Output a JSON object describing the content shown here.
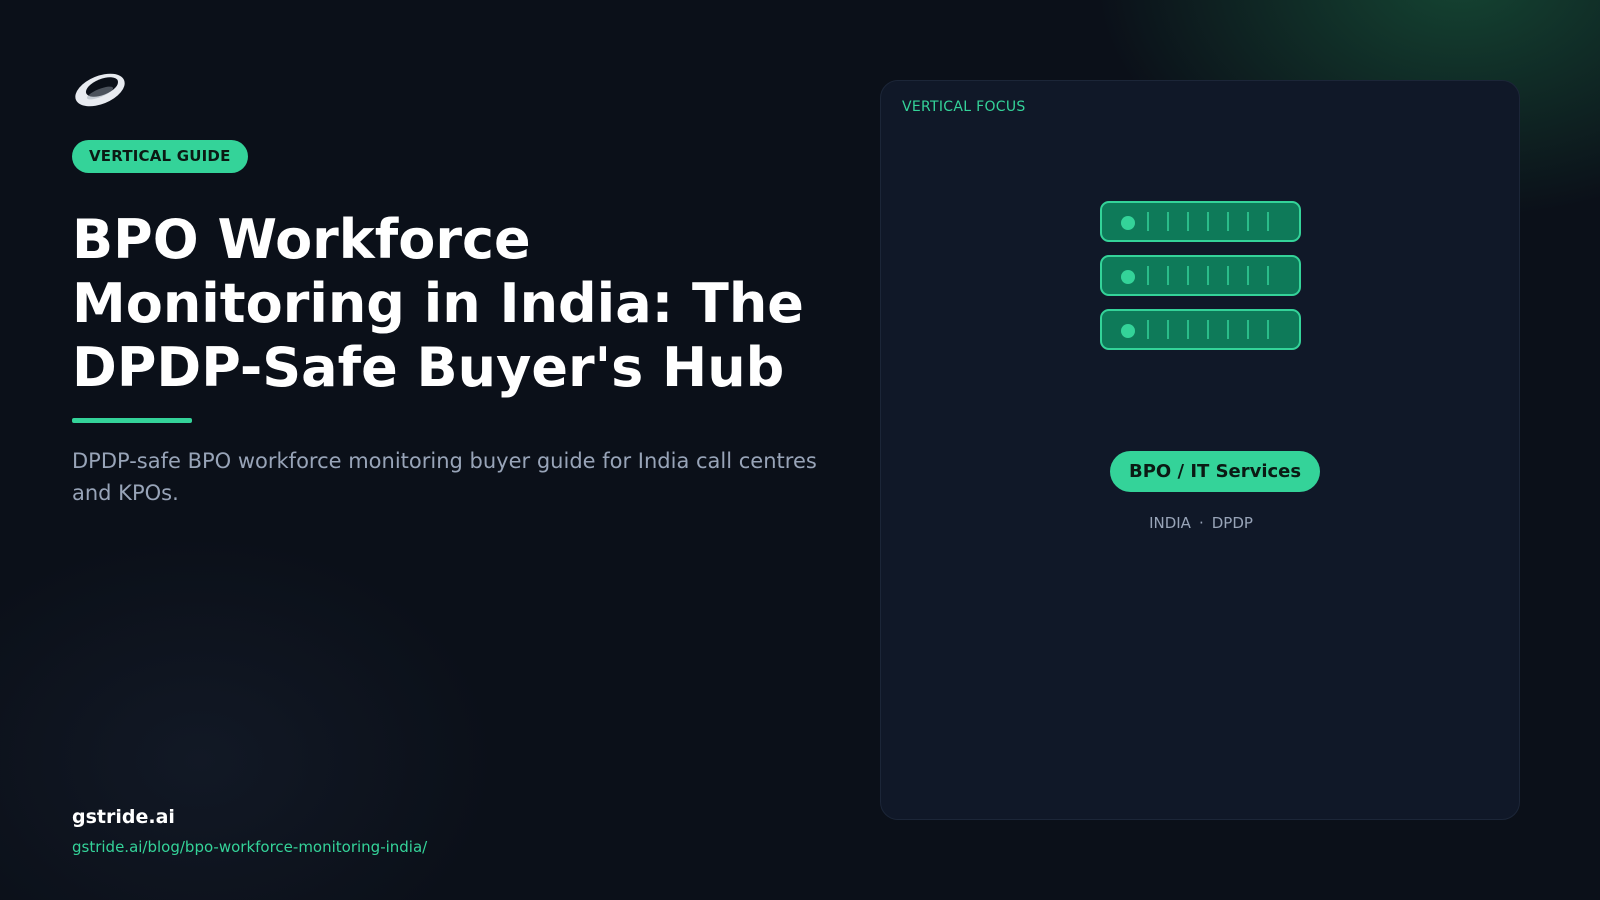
{
  "header": {
    "logo_icon": "ring-logo-icon"
  },
  "hero": {
    "tag": "VERTICAL GUIDE",
    "title": "BPO Workforce Monitoring in India: The DPDP-Safe Buyer's Hub",
    "subtitle": "DPDP-safe BPO workforce monitoring buyer guide for India call centres and KPOs."
  },
  "footer": {
    "brand": "gstride.ai",
    "url": "gstride.ai/blog/bpo-workforce-monitoring-india/"
  },
  "card": {
    "label": "VERTICAL FOCUS",
    "illustration_icon": "server-stack-icon",
    "badge": "BPO / IT Services",
    "meta": [
      "INDIA",
      "DPDP"
    ],
    "meta_separator": "·"
  },
  "colors": {
    "background": "#0b1019",
    "accent": "#34d399",
    "card_background": "#101828",
    "muted_text": "#98a4b8"
  }
}
